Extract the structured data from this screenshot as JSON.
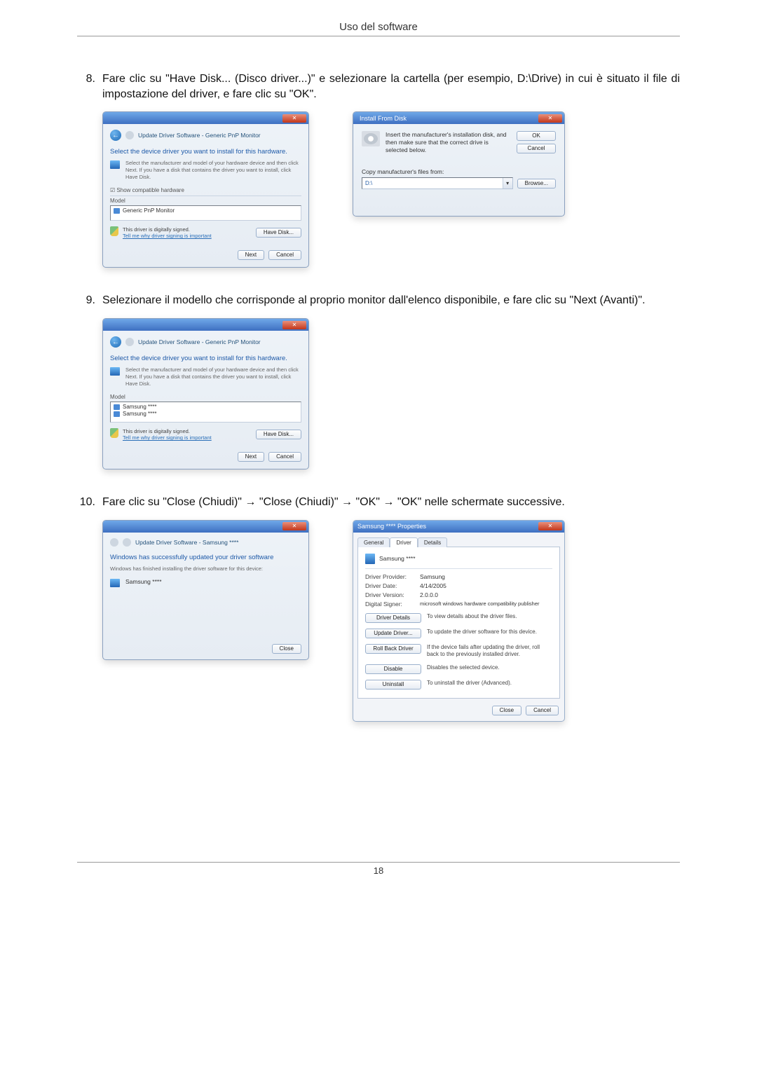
{
  "header": {
    "title": "Uso del software"
  },
  "pageNumber": "18",
  "steps": {
    "s8": {
      "num": "8.",
      "text": "Fare clic su \"Have Disk... (Disco driver...)\" e selezionare la cartella (per esempio, D:\\Drive) in cui è situato il file di impostazione del driver, e fare clic su \"OK\"."
    },
    "s9": {
      "num": "9.",
      "text": "Selezionare il modello che corrisponde al proprio monitor dall'elenco disponibile, e fare clic su \"Next (Avanti)\"."
    },
    "s10": {
      "num": "10.",
      "text": "Fare clic su \"Close (Chiudi)\" → \"Close (Chiudi)\" → \"OK\" → \"OK\" nelle schermate successive."
    }
  },
  "updateDriver": {
    "breadcrumb_generic": "Update Driver Software - Generic PnP Monitor",
    "breadcrumb_samsung": "Update Driver Software - Samsung ****",
    "heading": "Select the device driver you want to install for this hardware.",
    "subtext": "Select the manufacturer and model of your hardware device and then click Next. If you have a disk that contains the driver you want to install, click Have Disk.",
    "show_compat": "Show compatible hardware",
    "model_header": "Model",
    "item_generic": "Generic PnP Monitor",
    "item_samsung": "Samsung ****",
    "sig_text": "This driver is digitally signed.",
    "sig_link": "Tell me why driver signing is important",
    "have_disk": "Have Disk...",
    "next": "Next",
    "cancel": "Cancel"
  },
  "installFromDisk": {
    "title": "Install From Disk",
    "msg": "Insert the manufacturer's installation disk, and then make sure that the correct drive is selected below.",
    "ok": "OK",
    "cancel": "Cancel",
    "copy_label": "Copy manufacturer's files from:",
    "path": "D:\\",
    "browse": "Browse..."
  },
  "updateDone": {
    "heading": "Windows has successfully updated your driver software",
    "subtext": "Windows has finished installing the driver software for this device:",
    "device": "Samsung ****",
    "close": "Close"
  },
  "properties": {
    "title": "Samsung **** Properties",
    "tabs": {
      "general": "General",
      "driver": "Driver",
      "details": "Details"
    },
    "device": "Samsung ****",
    "rows": {
      "provider_l": "Driver Provider:",
      "provider_v": "Samsung",
      "date_l": "Driver Date:",
      "date_v": "4/14/2005",
      "version_l": "Driver Version:",
      "version_v": "2.0.0.0",
      "signer_l": "Digital Signer:",
      "signer_v": "microsoft windows hardware compatibility publisher"
    },
    "actions": {
      "details_btn": "Driver Details",
      "details_desc": "To view details about the driver files.",
      "update_btn": "Update Driver...",
      "update_desc": "To update the driver software for this device.",
      "rollback_btn": "Roll Back Driver",
      "rollback_desc": "If the device fails after updating the driver, roll back to the previously installed driver.",
      "disable_btn": "Disable",
      "disable_desc": "Disables the selected device.",
      "uninstall_btn": "Uninstall",
      "uninstall_desc": "To uninstall the driver (Advanced)."
    },
    "close": "Close",
    "cancel": "Cancel"
  }
}
